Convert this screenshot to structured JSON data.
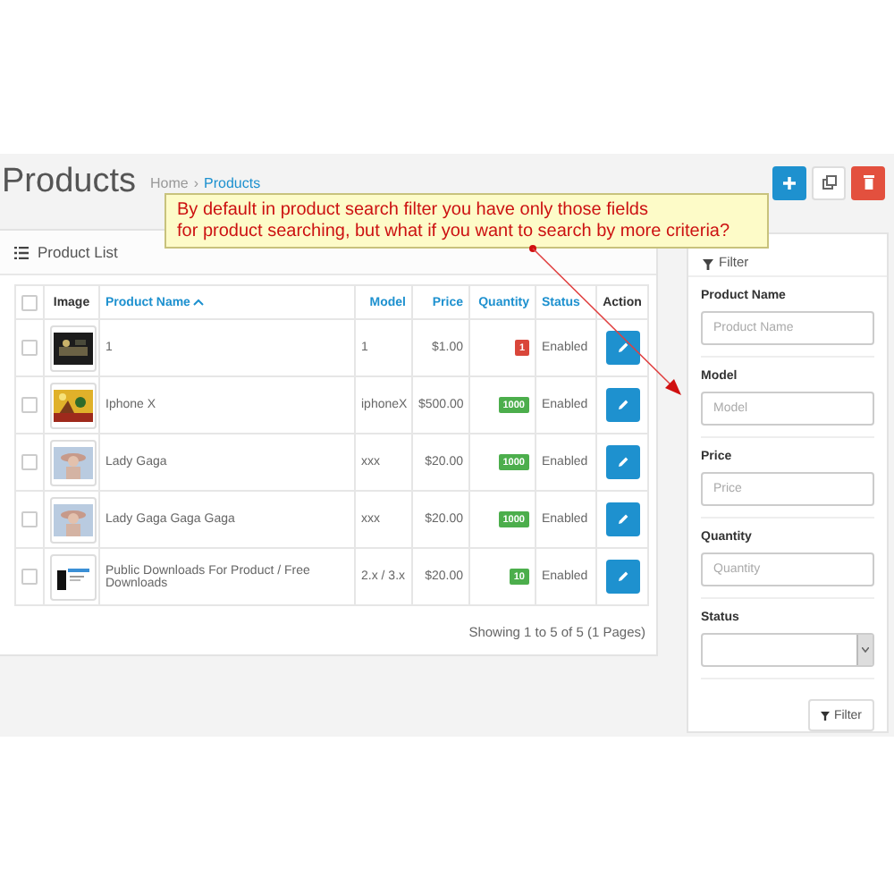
{
  "header": {
    "title": "Products",
    "breadcrumb": [
      {
        "label": "Home"
      },
      {
        "label": "Products"
      }
    ],
    "separator": "›",
    "buttons": [
      {
        "kind": "add"
      },
      {
        "kind": "copy"
      },
      {
        "kind": "delete"
      }
    ]
  },
  "callout": {
    "text": "By default in product search filter you have only those fields\nfor product searching, but what if you want to search by more criteria?"
  },
  "product_list": {
    "title": "Product List",
    "columns": [
      {
        "label": "Image",
        "link": false,
        "sorted": false
      },
      {
        "label": "Product Name",
        "link": true,
        "sorted": true
      },
      {
        "label": "Model",
        "link": true,
        "sorted": false
      },
      {
        "label": "Price",
        "link": true,
        "sorted": false
      },
      {
        "label": "Quantity",
        "link": true,
        "sorted": false
      },
      {
        "label": "Status",
        "link": true,
        "sorted": false
      },
      {
        "label": "Action",
        "link": false,
        "sorted": false
      }
    ],
    "select_all": {
      "checked": false
    },
    "rows": [
      {
        "checked": false,
        "name": "1",
        "model": "1",
        "price": "$1.00",
        "quantity": "1",
        "color": "#d9463a",
        "status": "Enabled"
      },
      {
        "checked": false,
        "name": "Iphone X",
        "model": "iphoneX",
        "price": "$500.00",
        "quantity": "1000",
        "color": "#4cae4c",
        "status": "Enabled"
      },
      {
        "checked": false,
        "name": "Lady Gaga",
        "model": "xxx",
        "price": "$20.00",
        "quantity": "1000",
        "color": "#4cae4c",
        "status": "Enabled"
      },
      {
        "checked": false,
        "name": "Lady Gaga Gaga Gaga",
        "model": "xxx",
        "price": "$20.00",
        "quantity": "1000",
        "color": "#4cae4c",
        "status": "Enabled"
      },
      {
        "checked": false,
        "name": "Public Downloads For Product / Free Downloads",
        "model": "2.x / 3.x",
        "price": "$20.00",
        "quantity": "10",
        "color": "#4cae4c",
        "status": "Enabled"
      }
    ],
    "pagination": "Showing 1 to 5 of 5 (1 Pages)"
  },
  "filter": {
    "title": "Filter",
    "fields": [
      {
        "kind": "text",
        "label": "Product Name",
        "placeholder": "Product Name"
      },
      {
        "kind": "text",
        "label": "Model",
        "placeholder": "Model"
      },
      {
        "kind": "text",
        "label": "Price",
        "placeholder": "Price"
      },
      {
        "kind": "text",
        "label": "Quantity",
        "placeholder": "Quantity"
      },
      {
        "kind": "select",
        "label": "Status"
      }
    ],
    "button": "Filter"
  }
}
